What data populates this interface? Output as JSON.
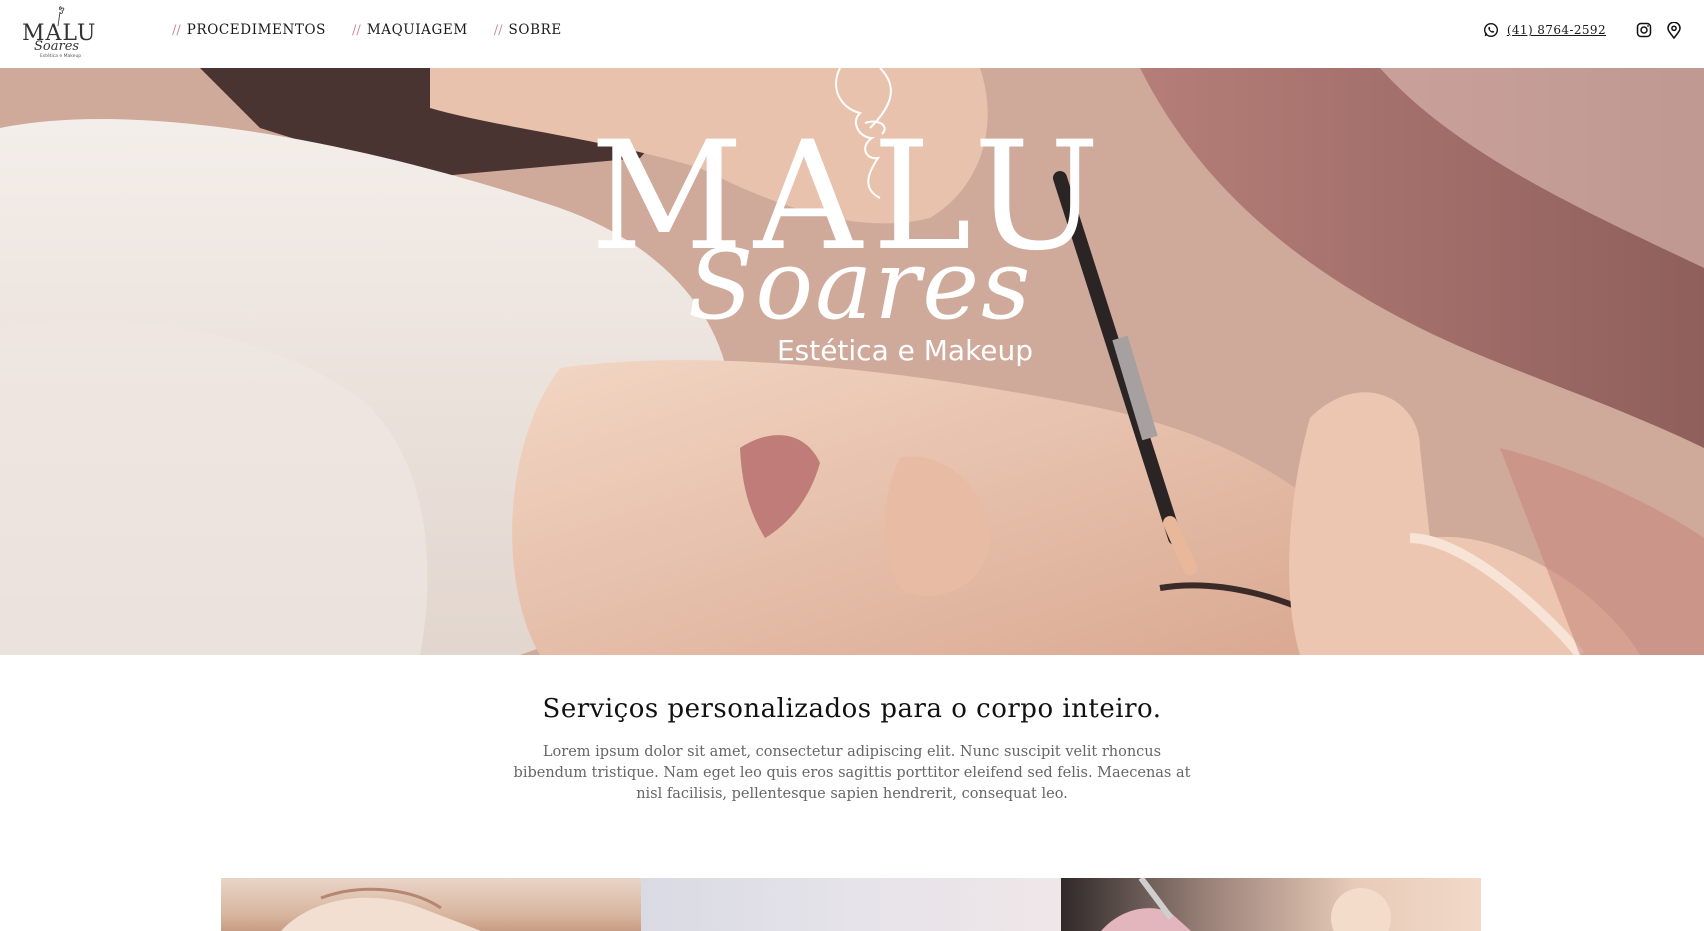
{
  "brand": {
    "logo_top": "MALU",
    "logo_script": "Soares",
    "logo_tagline": "Estética e Makeup"
  },
  "nav": {
    "items": [
      {
        "slash": "//",
        "label": "PROCEDIMENTOS"
      },
      {
        "slash": "//",
        "label": "MAQUIAGEM"
      },
      {
        "slash": "//",
        "label": "SOBRE"
      }
    ]
  },
  "contact": {
    "phone": "(41) 8764-2592",
    "icons": [
      "whatsapp-icon",
      "instagram-icon",
      "location-pin-icon"
    ]
  },
  "services": {
    "title": "Serviços personalizados para o corpo inteiro.",
    "text": "Lorem ipsum dolor sit amet, consectetur adipiscing elit. Nunc suscipit velit rhoncus bibendum tristique. Nam eget leo quis eros sagittis porttitor eleifend sed felis. Maecenas at nisl facilisis, pellentesque sapien hendrerit, consequat leo."
  },
  "colors": {
    "accent_slash": "#c98b8f",
    "text_dark": "#1a1a1a",
    "text_muted": "#666666"
  }
}
